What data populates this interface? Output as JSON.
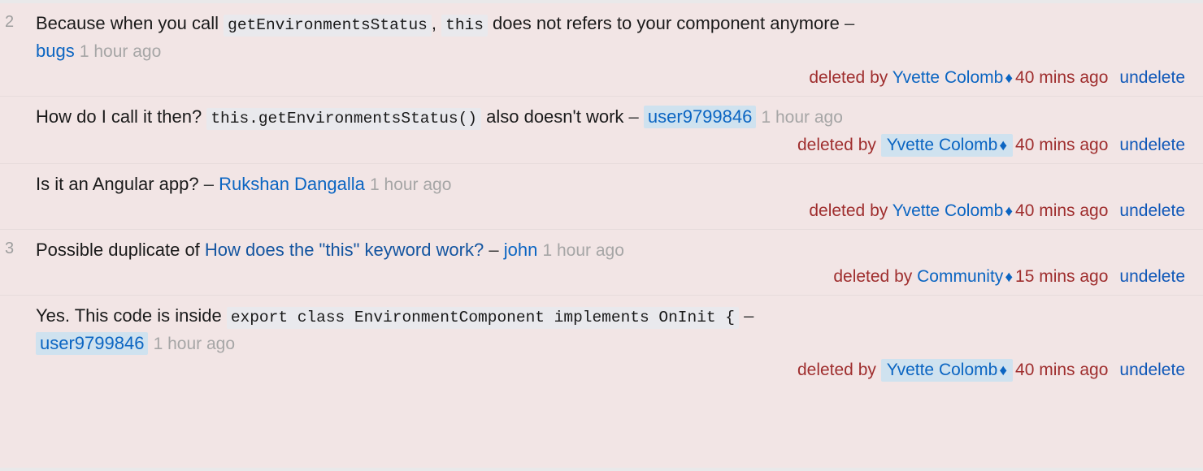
{
  "panel": {
    "background_color": "#f2e5e5",
    "page_background_color": "#e9e9ea",
    "deleted_text_color": "#9f2e2e",
    "link_color": "#0b65c2",
    "undelete_color": "#1058b8",
    "highlight_color": "#cfe2ef",
    "code_background_color": "#e9e9ed",
    "timestamp_color": "#a6a6a6"
  },
  "comments": [
    {
      "score": "2",
      "body": {
        "text_1": "Because when you call ",
        "code_1": "getEnvironmentsStatus",
        "text_2": ", ",
        "code_2": "this",
        "text_3": " does not refers to your component anymore",
        "dash": "–",
        "author": "bugs",
        "author_highlighted": false,
        "age": "1 hour ago"
      },
      "deleted": {
        "prefix": "deleted by",
        "moderator": "Yvette Colomb",
        "moderator_highlighted": false,
        "diamond": "♦",
        "age": "40 mins ago",
        "action": "undelete"
      }
    },
    {
      "score": "",
      "body": {
        "text_1": "How do I call it then? ",
        "code_1": "this.getEnvironmentsStatus()",
        "text_2": " also doesn't work",
        "dash": "–",
        "author": "user9799846",
        "author_highlighted": true,
        "age": "1 hour ago"
      },
      "deleted": {
        "prefix": "deleted by",
        "moderator": "Yvette Colomb",
        "moderator_highlighted": true,
        "diamond": "♦",
        "age": "40 mins ago",
        "action": "undelete"
      }
    },
    {
      "score": "",
      "body": {
        "text_1": "Is it an Angular app?",
        "dash": "–",
        "author": "Rukshan Dangalla",
        "author_highlighted": false,
        "age": "1 hour ago"
      },
      "deleted": {
        "prefix": "deleted by",
        "moderator": "Yvette Colomb",
        "moderator_highlighted": false,
        "diamond": "♦",
        "age": "40 mins ago",
        "action": "undelete"
      }
    },
    {
      "score": "3",
      "body": {
        "text_1": "Possible duplicate of ",
        "post_link": "How does the \"this\" keyword work?",
        "dash": "–",
        "author": "john",
        "author_highlighted": false,
        "age": "1 hour ago"
      },
      "deleted": {
        "prefix": "deleted by",
        "moderator": "Community",
        "moderator_highlighted": false,
        "diamond": "♦",
        "age": "15 mins ago",
        "action": "undelete"
      }
    },
    {
      "score": "",
      "body": {
        "text_1": "Yes. This code is inside ",
        "code_1": "export class EnvironmentComponent implements OnInit {",
        "dash": "–",
        "author": "user9799846",
        "author_highlighted": true,
        "age": "1 hour ago"
      },
      "deleted": {
        "prefix": "deleted by",
        "moderator": "Yvette Colomb",
        "moderator_highlighted": true,
        "diamond": "♦",
        "age": "40 mins ago",
        "action": "undelete"
      }
    }
  ]
}
